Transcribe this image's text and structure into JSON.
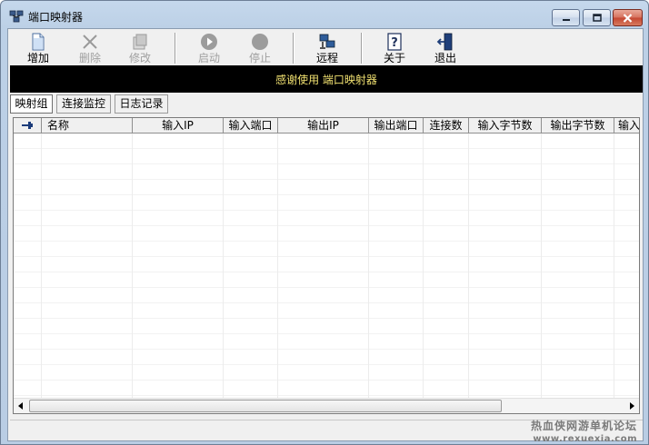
{
  "window": {
    "title": "端口映射器"
  },
  "toolbar": {
    "buttons": [
      {
        "label": "增加",
        "icon": "document-add-icon",
        "enabled": true
      },
      {
        "label": "删除",
        "icon": "delete-x-icon",
        "enabled": false
      },
      {
        "label": "修改",
        "icon": "edit-icon",
        "enabled": false
      },
      {
        "label": "启动",
        "icon": "play-icon",
        "enabled": false
      },
      {
        "label": "停止",
        "icon": "stop-icon",
        "enabled": false
      },
      {
        "label": "远程",
        "icon": "remote-computer-icon",
        "enabled": true
      },
      {
        "label": "关于",
        "icon": "help-icon",
        "enabled": true
      },
      {
        "label": "退出",
        "icon": "exit-door-icon",
        "enabled": true
      }
    ]
  },
  "banner": {
    "text": "感谢使用 端口映射器"
  },
  "tabs": [
    {
      "label": "映射组",
      "active": true
    },
    {
      "label": "连接监控",
      "active": false
    },
    {
      "label": "日志记录",
      "active": false
    }
  ],
  "table": {
    "columns": [
      "名称",
      "输入IP",
      "输入端口",
      "输出IP",
      "输出端口",
      "连接数",
      "输入字节数",
      "输出字节数",
      "输入"
    ],
    "rows": []
  },
  "watermark": {
    "line1": "热血侠网游单机论坛",
    "line2": "www.rexuexia.com"
  },
  "colors": {
    "banner_bg": "#000000",
    "banner_text": "#f0e070"
  }
}
